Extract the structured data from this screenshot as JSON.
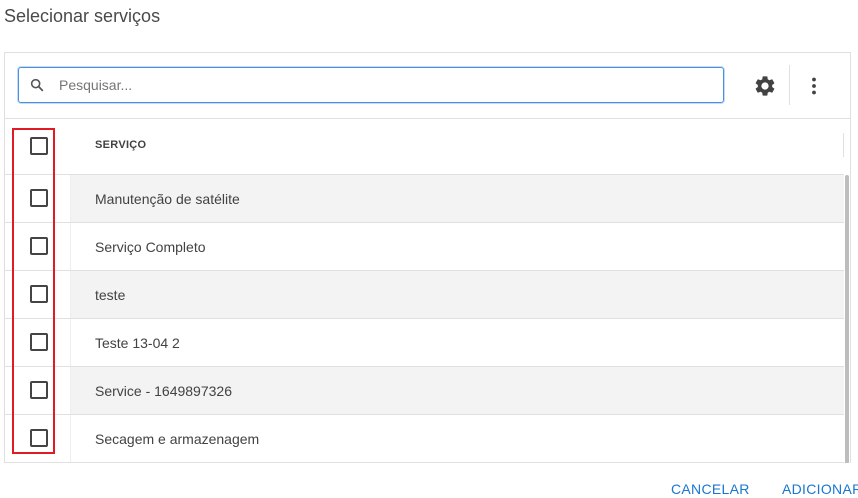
{
  "dialog": {
    "title": "Selecionar serviços"
  },
  "search": {
    "placeholder": "Pesquisar..."
  },
  "toolbar": {
    "settings_icon": "gear-icon",
    "more_icon": "more-vert-icon"
  },
  "table": {
    "header": "SERVIÇO",
    "rows": [
      {
        "label": "Manutenção de satélite",
        "checked": false
      },
      {
        "label": "Serviço Completo",
        "checked": false
      },
      {
        "label": "teste",
        "checked": false
      },
      {
        "label": "Teste 13-04 2",
        "checked": false
      },
      {
        "label": "Service - 1649897326",
        "checked": false
      },
      {
        "label": "Secagem e armazenagem",
        "checked": false
      }
    ]
  },
  "footer": {
    "cancel_label": "CANCELAR",
    "add_label": "ADICIONAR"
  },
  "colors": {
    "accent": "#1976d2",
    "highlight": "#e01b24",
    "row_alt": "#f3f3f3"
  }
}
